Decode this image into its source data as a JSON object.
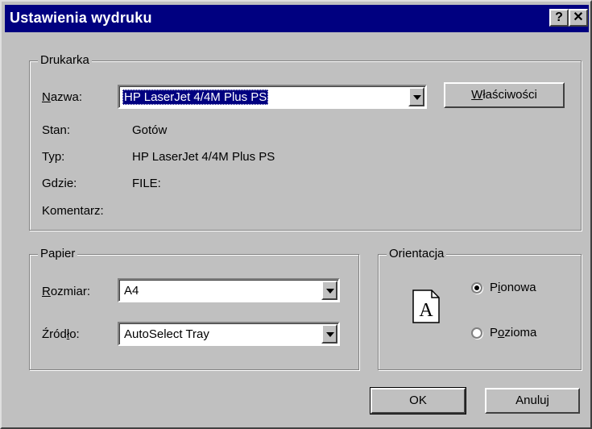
{
  "window": {
    "title": "Ustawienia wydruku",
    "help_label": "?",
    "close_label": "✕"
  },
  "printer_group": {
    "legend": "Drukarka",
    "name_label_u": "N",
    "name_label_rest": "azwa:",
    "name_value": "HP LaserJet 4/4M Plus PS",
    "properties_label_u": "W",
    "properties_label_rest": "łaściwości",
    "status_label": "Stan:",
    "status_value": "Gotów",
    "type_label": "Typ:",
    "type_value": "HP LaserJet 4/4M Plus PS",
    "where_label": "Gdzie:",
    "where_value": "FILE:",
    "comment_label": "Komentarz:"
  },
  "paper_group": {
    "legend": "Papier",
    "size_label_u": "R",
    "size_label_rest": "ozmiar:",
    "size_value": "A4",
    "source_label_pre": "Źród",
    "source_label_u": "ł",
    "source_label_rest": "o:",
    "source_value": "AutoSelect Tray"
  },
  "orientation_group": {
    "legend": "Orientacja",
    "page_letter": "A",
    "portrait_pre": "P",
    "portrait_u": "i",
    "portrait_rest": "onowa",
    "portrait_checked": true,
    "landscape_pre": "P",
    "landscape_u": "o",
    "landscape_rest": "zioma",
    "landscape_checked": false
  },
  "buttons": {
    "ok_label": "OK",
    "cancel_label": "Anuluj"
  }
}
